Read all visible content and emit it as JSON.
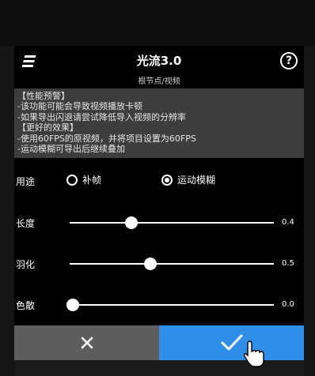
{
  "dialog": {
    "title": "光流3.0",
    "subtitle": "根节点/视频",
    "info_lines": [
      "【性能预警】",
      "-该功能可能会导致视频播放卡顿",
      "-如果导出闪退请尝试降低导入视频的分辨率",
      "【更好的效果】",
      "-使用60FPS的原视频，并将项目设置为60FPS",
      "-运动模糊可导出后继续叠加"
    ],
    "usage": {
      "label": "用途",
      "options": [
        {
          "label": "补帧",
          "selected": false
        },
        {
          "label": "运动模糊",
          "selected": true
        }
      ]
    },
    "sliders": [
      {
        "label": "长度",
        "value": 0.4,
        "display": "0.4"
      },
      {
        "label": "羽化",
        "value": 0.5,
        "display": "0.5"
      },
      {
        "label": "色散",
        "value": 0.0,
        "display": "0.0"
      }
    ],
    "cancel_icon": "close-icon",
    "confirm_icon": "check-icon"
  },
  "colors": {
    "confirm_blue": "#2f8fe8",
    "cancel_gray": "#5d5d5d",
    "info_bg": "#3d3d3d"
  }
}
